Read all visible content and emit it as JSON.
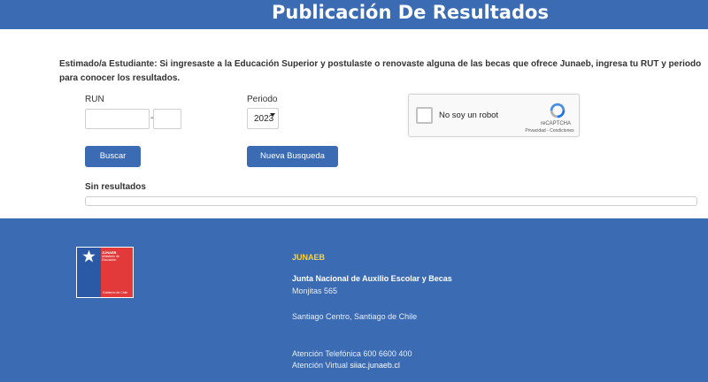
{
  "header": {
    "title": "Publicación De Resultados"
  },
  "intro": {
    "text": "Estimado/a Estudiante: Si ingresaste a la Educación Superior y postulaste o renovaste alguna de las becas que ofrece Junaeb, ingresa tu RUT y periodo para conocer los resultados."
  },
  "form": {
    "run_label": "RUN",
    "run_value": "",
    "dv_value": "",
    "dash": "-",
    "periodo_label": "Periodo",
    "periodo_selected": "2023",
    "search_button": "Buscar",
    "new_search_button": "Nueva Busqueda"
  },
  "captcha": {
    "label": "No soy un robot",
    "brand": "reCAPTCHA",
    "links": "Privacidad - Condiciones",
    "checked": false
  },
  "results": {
    "label": "Sin resultados"
  },
  "footer": {
    "logo": {
      "line1": "JUNAEB",
      "line2": "Ministerio de",
      "line3": "Educación",
      "line4": "Gobierno de Chile"
    },
    "org_short": "JUNAEB",
    "org_name": "Junta Nacional de Auxilio Escolar y Becas",
    "address": "Monjitas 565",
    "city": "Santiago Centro, Santiago de Chile",
    "phone": "Atención Telefónica 600 6600 400",
    "virtual_label": "Atención Virtual",
    "virtual_link": "siiac.junaeb.cl"
  },
  "colors": {
    "brand_blue": "#3a6bb3",
    "accent_yellow": "#ffd23a",
    "logo_red": "#e23a3a"
  },
  "icons": {
    "captcha": "recaptcha-icon",
    "logo_star": "star-icon",
    "select": "chevron-down-icon"
  }
}
